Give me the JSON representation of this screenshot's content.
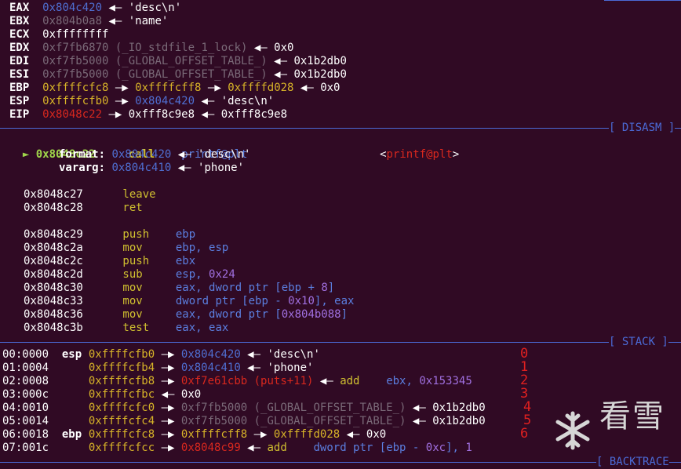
{
  "registers": [
    {
      "name": "EAX",
      "parts": [
        {
          "t": "0x804c420",
          "c": "addr-blue"
        },
        {
          "t": " ◀— ",
          "c": "white"
        },
        {
          "t": "'desc\\n'",
          "c": "white"
        }
      ]
    },
    {
      "name": "EBX",
      "parts": [
        {
          "t": "0x804b0a8",
          "c": "addr-gray"
        },
        {
          "t": " ◀— ",
          "c": "white"
        },
        {
          "t": "'name'",
          "c": "white"
        }
      ]
    },
    {
      "name": "ECX",
      "parts": [
        {
          "t": "0xffffffff",
          "c": "white"
        }
      ]
    },
    {
      "name": "EDX",
      "parts": [
        {
          "t": "0xf7fb6870 (_IO_stdfile_1_lock)",
          "c": "addr-gray"
        },
        {
          "t": " ◀— ",
          "c": "white"
        },
        {
          "t": "0x0",
          "c": "white"
        }
      ]
    },
    {
      "name": "EDI",
      "parts": [
        {
          "t": "0xf7fb5000 (_GLOBAL_OFFSET_TABLE_)",
          "c": "addr-gray"
        },
        {
          "t": " ◀— ",
          "c": "white"
        },
        {
          "t": "0x1b2db0",
          "c": "white"
        }
      ]
    },
    {
      "name": "ESI",
      "parts": [
        {
          "t": "0xf7fb5000 (_GLOBAL_OFFSET_TABLE_)",
          "c": "addr-gray"
        },
        {
          "t": " ◀— ",
          "c": "white"
        },
        {
          "t": "0x1b2db0",
          "c": "white"
        }
      ]
    },
    {
      "name": "EBP",
      "parts": [
        {
          "t": "0xffffcfc8",
          "c": "addr-yellow"
        },
        {
          "t": " —▶ ",
          "c": "white"
        },
        {
          "t": "0xffffcff8",
          "c": "addr-yellow"
        },
        {
          "t": " —▶ ",
          "c": "white"
        },
        {
          "t": "0xffffd028",
          "c": "addr-yellow"
        },
        {
          "t": " ◀— ",
          "c": "white"
        },
        {
          "t": "0x0",
          "c": "white"
        }
      ]
    },
    {
      "name": "ESP",
      "parts": [
        {
          "t": "0xffffcfb0",
          "c": "addr-yellow"
        },
        {
          "t": " —▶ ",
          "c": "white"
        },
        {
          "t": "0x804c420",
          "c": "addr-blue"
        },
        {
          "t": " ◀— ",
          "c": "white"
        },
        {
          "t": "'desc\\n'",
          "c": "white"
        }
      ]
    },
    {
      "name": "EIP",
      "parts": [
        {
          "t": "0x8048c22",
          "c": "addr-red"
        },
        {
          "t": " —▶ ",
          "c": "white"
        },
        {
          "t": "0xfff8c9e8",
          "c": "white"
        },
        {
          "t": " ◀— ",
          "c": "white"
        },
        {
          "t": "0xfff8c9e8",
          "c": "white"
        }
      ]
    }
  ],
  "sections": {
    "disasm": "[ DISASM ]",
    "stack": "[ STACK ]",
    "backtrace": "[ BACKTRACE"
  },
  "disasm": {
    "current": {
      "marker": "►",
      "addr": "0x8048c22",
      "mnemonic": "call",
      "operand": "printf@plt",
      "target_open": "<",
      "target": "printf@plt",
      "target_close": ">"
    },
    "args": [
      {
        "name": "format:",
        "value": "0x804c420",
        "arrow": " ◀— ",
        "str": "'desc\\n'"
      },
      {
        "name": "vararg:",
        "value": "0x804c410",
        "arrow": " ◀— ",
        "str": "'phone'"
      }
    ],
    "lines": [
      [
        {
          "t": "0x8048c27",
          "c": "white"
        },
        {
          "t": "      leave",
          "c": "mnem-yellow"
        }
      ],
      [
        {
          "t": "0x8048c28",
          "c": "white"
        },
        {
          "t": "      ret",
          "c": "mnem-yellow"
        }
      ],
      [],
      [
        {
          "t": "0x8048c29",
          "c": "white"
        },
        {
          "t": "      push    ",
          "c": "mnem-yellow"
        },
        {
          "t": "ebp",
          "c": "op-blue"
        }
      ],
      [
        {
          "t": "0x8048c2a",
          "c": "white"
        },
        {
          "t": "      mov     ",
          "c": "mnem-yellow"
        },
        {
          "t": "ebp, esp",
          "c": "op-blue"
        }
      ],
      [
        {
          "t": "0x8048c2c",
          "c": "white"
        },
        {
          "t": "      push    ",
          "c": "mnem-yellow"
        },
        {
          "t": "ebx",
          "c": "op-blue"
        }
      ],
      [
        {
          "t": "0x8048c2d",
          "c": "white"
        },
        {
          "t": "      sub     ",
          "c": "mnem-yellow"
        },
        {
          "t": "esp, ",
          "c": "op-blue"
        },
        {
          "t": "0x24",
          "c": "imm-purple"
        }
      ],
      [
        {
          "t": "0x8048c30",
          "c": "white"
        },
        {
          "t": "      mov     ",
          "c": "mnem-yellow"
        },
        {
          "t": "eax, dword ptr [ebp + ",
          "c": "op-blue"
        },
        {
          "t": "8",
          "c": "imm-purple"
        },
        {
          "t": "]",
          "c": "op-blue"
        }
      ],
      [
        {
          "t": "0x8048c33",
          "c": "white"
        },
        {
          "t": "      mov     ",
          "c": "mnem-yellow"
        },
        {
          "t": "dword ptr [ebp - ",
          "c": "op-blue"
        },
        {
          "t": "0x10",
          "c": "imm-purple"
        },
        {
          "t": "], eax",
          "c": "op-blue"
        }
      ],
      [
        {
          "t": "0x8048c36",
          "c": "white"
        },
        {
          "t": "      mov     ",
          "c": "mnem-yellow"
        },
        {
          "t": "eax, dword ptr [",
          "c": "op-blue"
        },
        {
          "t": "0x804b088",
          "c": "imm-purple"
        },
        {
          "t": "]",
          "c": "op-blue"
        }
      ],
      [
        {
          "t": "0x8048c3b",
          "c": "white"
        },
        {
          "t": "      test    ",
          "c": "mnem-yellow"
        },
        {
          "t": "eax, eax",
          "c": "op-blue"
        }
      ]
    ]
  },
  "stack": [
    {
      "idx": "00:0000",
      "reg": "esp",
      "parts": [
        {
          "t": "0xffffcfb0",
          "c": "addr-yellow"
        },
        {
          "t": " —▶ ",
          "c": "white"
        },
        {
          "t": "0x804c420",
          "c": "addr-blue"
        },
        {
          "t": " ◀— ",
          "c": "white"
        },
        {
          "t": "'desc\\n'",
          "c": "white"
        }
      ],
      "tag": "0"
    },
    {
      "idx": "01:0004",
      "reg": "",
      "parts": [
        {
          "t": "0xffffcfb4",
          "c": "addr-yellow"
        },
        {
          "t": " —▶ ",
          "c": "white"
        },
        {
          "t": "0x804c410",
          "c": "addr-blue"
        },
        {
          "t": " ◀— ",
          "c": "white"
        },
        {
          "t": "'phone'",
          "c": "white"
        }
      ],
      "tag": "1"
    },
    {
      "idx": "02:0008",
      "reg": "",
      "parts": [
        {
          "t": "0xffffcfb8",
          "c": "addr-yellow"
        },
        {
          "t": " —▶ ",
          "c": "white"
        },
        {
          "t": "0xf7e61cbb (puts+11)",
          "c": "addr-red"
        },
        {
          "t": " ◀— ",
          "c": "white"
        },
        {
          "t": "add",
          "c": "mnem-yellow"
        },
        {
          "t": "    ebx, ",
          "c": "op-blue"
        },
        {
          "t": "0x153345",
          "c": "imm-purple"
        }
      ],
      "tag": "2"
    },
    {
      "idx": "03:000c",
      "reg": "",
      "parts": [
        {
          "t": "0xffffcfbc",
          "c": "addr-yellow"
        },
        {
          "t": " ◀— ",
          "c": "white"
        },
        {
          "t": "0x0",
          "c": "white"
        }
      ],
      "tag": "3"
    },
    {
      "idx": "04:0010",
      "reg": "",
      "parts": [
        {
          "t": "0xffffcfc0",
          "c": "addr-yellow"
        },
        {
          "t": " —▶ ",
          "c": "white"
        },
        {
          "t": "0xf7fb5000 (_GLOBAL_OFFSET_TABLE_)",
          "c": "addr-gray"
        },
        {
          "t": " ◀— ",
          "c": "white"
        },
        {
          "t": "0x1b2db0",
          "c": "white"
        }
      ],
      "tag": "4"
    },
    {
      "idx": "05:0014",
      "reg": "",
      "parts": [
        {
          "t": "0xffffcfc4",
          "c": "addr-yellow"
        },
        {
          "t": " —▶ ",
          "c": "white"
        },
        {
          "t": "0xf7fb5000 (_GLOBAL_OFFSET_TABLE_)",
          "c": "addr-gray"
        },
        {
          "t": " ◀— ",
          "c": "white"
        },
        {
          "t": "0x1b2db0",
          "c": "white"
        }
      ],
      "tag": "5"
    },
    {
      "idx": "06:0018",
      "reg": "ebp",
      "parts": [
        {
          "t": "0xffffcfc8",
          "c": "addr-yellow"
        },
        {
          "t": " —▶ ",
          "c": "white"
        },
        {
          "t": "0xffffcff8",
          "c": "addr-yellow"
        },
        {
          "t": " —▶ ",
          "c": "white"
        },
        {
          "t": "0xffffd028",
          "c": "addr-yellow"
        },
        {
          "t": " ◀— ",
          "c": "white"
        },
        {
          "t": "0x0",
          "c": "white"
        }
      ],
      "tag": "6"
    },
    {
      "idx": "07:001c",
      "reg": "",
      "parts": [
        {
          "t": "0xffffcfcc",
          "c": "addr-yellow"
        },
        {
          "t": " —▶ ",
          "c": "white"
        },
        {
          "t": "0x8048c99",
          "c": "addr-red"
        },
        {
          "t": " ◀— ",
          "c": "white"
        },
        {
          "t": "add",
          "c": "mnem-yellow"
        },
        {
          "t": "    dword ptr [ebp - ",
          "c": "op-blue"
        },
        {
          "t": "0xc",
          "c": "imm-purple"
        },
        {
          "t": "], ",
          "c": "op-blue"
        },
        {
          "t": "1",
          "c": "imm-purple"
        }
      ],
      "tag": ""
    }
  ],
  "watermark": {
    "text": "看雪",
    "icon": "snowflake-icon"
  }
}
